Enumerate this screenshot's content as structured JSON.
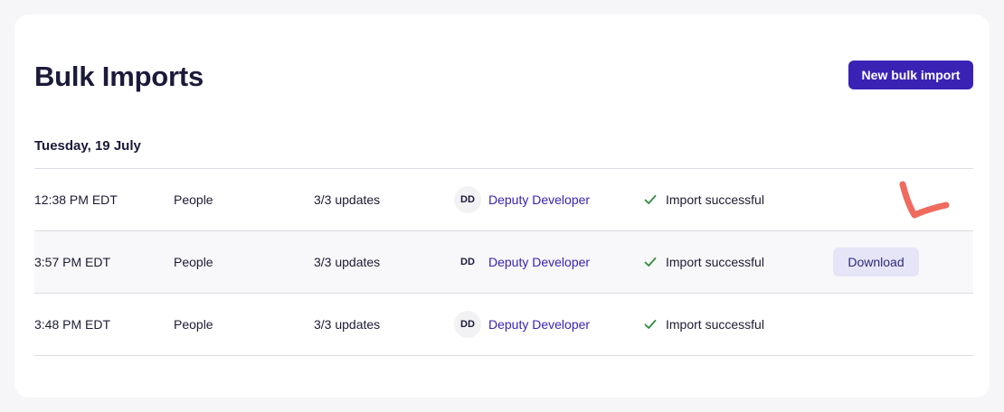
{
  "page": {
    "title": "Bulk Imports",
    "new_button_label": "New bulk import"
  },
  "group": {
    "date": "Tuesday, 19 July"
  },
  "rows": [
    {
      "time": "12:38 PM EDT",
      "type": "People",
      "updates": "3/3 updates",
      "user_initials": "DD",
      "user_name": "Deputy Developer",
      "status": "Import successful"
    },
    {
      "time": "3:57 PM EDT",
      "type": "People",
      "updates": "3/3 updates",
      "user_initials": "DD",
      "user_name": "Deputy Developer",
      "status": "Import successful",
      "action_label": "Download"
    },
    {
      "time": "3:48 PM EDT",
      "type": "People",
      "updates": "3/3 updates",
      "user_initials": "DD",
      "user_name": "Deputy Developer",
      "status": "Import successful"
    }
  ],
  "icons": {
    "status": "check-icon",
    "annotation": "red-checkmark-annotation"
  },
  "colors": {
    "brand": "#3a22b5",
    "success": "#2e8b3a",
    "annotation": "#f06a5e"
  }
}
